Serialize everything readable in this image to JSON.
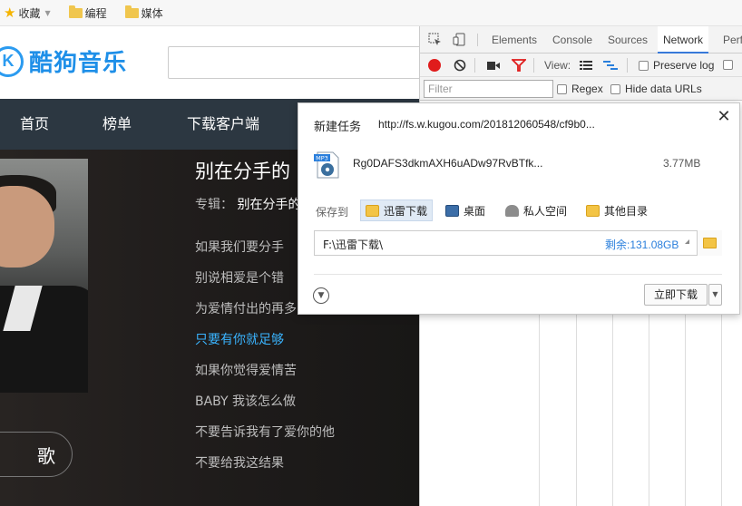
{
  "bookmarks": {
    "favorites": "收藏",
    "folders": [
      "编程",
      "媒体"
    ]
  },
  "kugou": {
    "logo_letter": "K",
    "logo_text": "酷狗音乐",
    "nav": [
      "首页",
      "榜单",
      "下载客户端"
    ],
    "song_title": "别在分手的",
    "album_label": "专辑：",
    "album_name": "别在分手的",
    "lyrics": [
      "如果我们要分手",
      "别说相爱是个错",
      "为爱情付出的再多",
      "只要有你就足够",
      "如果你觉得爱情苦",
      "BABY 我该怎么做",
      "不要告诉我有了爱你的他",
      "不要给我这结果"
    ],
    "active_lyric_index": 3,
    "sing_button": "歌"
  },
  "devtools": {
    "tabs": [
      "Elements",
      "Console",
      "Sources",
      "Network",
      "Perfo"
    ],
    "active_tab": "Network",
    "view_label": "View:",
    "preserve_log": "Preserve log",
    "filter_placeholder": "Filter",
    "regex": "Regex",
    "hide_data_urls": "Hide data URLs"
  },
  "dialog": {
    "title": "新建任务",
    "url": "http://fs.w.kugou.com/201812060548/cf9b0...",
    "file_icon_label": "MP3",
    "file_name": "Rg0DAFS3dkmAXH6uADw97RvBTfk...",
    "file_size": "3.77MB",
    "save_to": "保存到",
    "locations": [
      "迅雷下载",
      "桌面",
      "私人空间",
      "其他目录"
    ],
    "selected_location": "迅雷下载",
    "path": "F:\\迅雷下载\\",
    "free_space": "剩余:131.08GB",
    "download_now": "立即下载"
  },
  "colors": {
    "accent_blue": "#2b9bf0",
    "nav_bg": "#2c3741",
    "active_lyric": "#3ab4ff",
    "network_record": "#e01c1c"
  }
}
